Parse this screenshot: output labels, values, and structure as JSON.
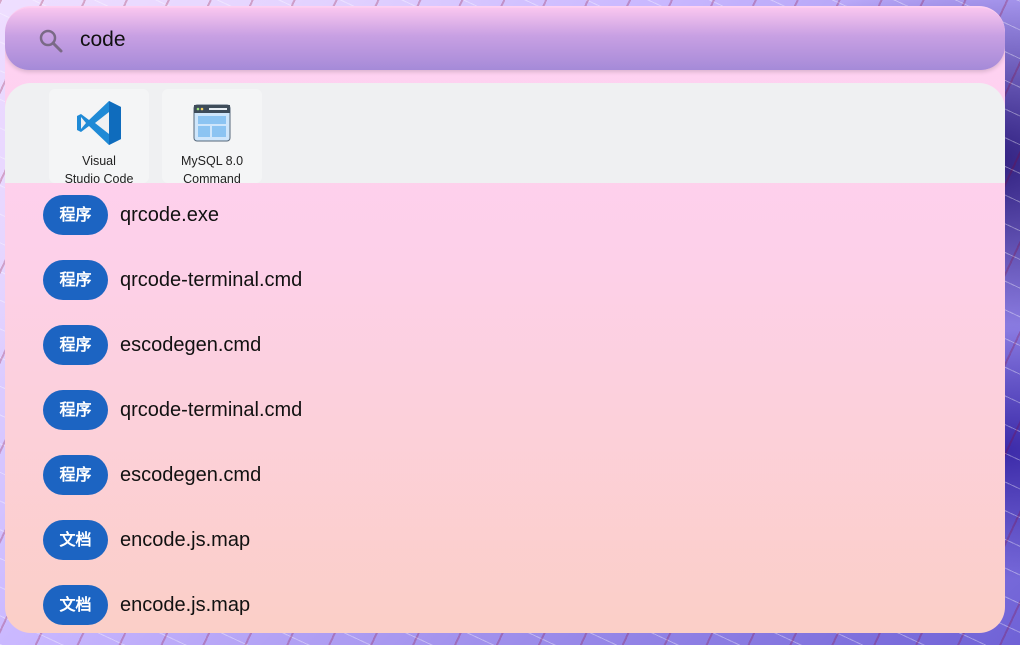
{
  "search": {
    "value": "code",
    "icon": "search-icon"
  },
  "apps": [
    {
      "label_line1": "Visual",
      "label_line2": "Studio Code",
      "icon": "vscode-icon"
    },
    {
      "label_line1": "MySQL 8.0",
      "label_line2": "Command",
      "icon": "terminal-window-icon"
    }
  ],
  "results": [
    {
      "badge": "程序",
      "name": "qrcode.exe"
    },
    {
      "badge": "程序",
      "name": "qrcode-terminal.cmd"
    },
    {
      "badge": "程序",
      "name": "escodegen.cmd"
    },
    {
      "badge": "程序",
      "name": "qrcode-terminal.cmd"
    },
    {
      "badge": "程序",
      "name": "escodegen.cmd"
    },
    {
      "badge": "文档",
      "name": "encode.js.map"
    },
    {
      "badge": "文档",
      "name": "encode.js.map"
    }
  ],
  "colors": {
    "badge": "#1c64c2",
    "search_bar_top": "#f9c6ef",
    "search_bar_bottom": "#a58ad8",
    "panel_top": "#ffd2f4",
    "panel_bottom": "#fbcfc7"
  }
}
